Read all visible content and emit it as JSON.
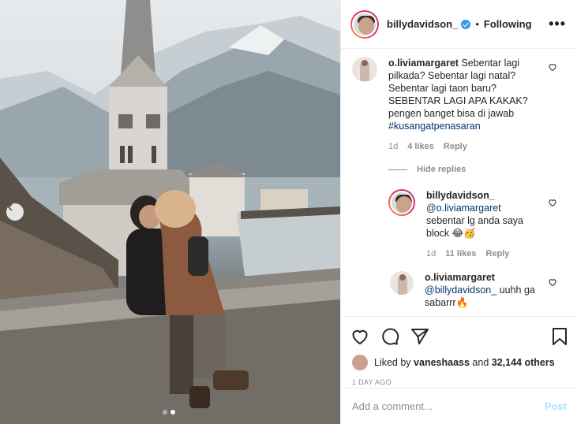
{
  "header": {
    "username": "billydavidson_",
    "separator": "•",
    "follow_status": "Following",
    "more_label": "•••"
  },
  "comments": [
    {
      "user": "o.liviamargaret",
      "text": "Sebentar lagi pilkada? Sebentar lagi natal? Sebentar lagi taon baru? SEBENTAR LAGI APA KAKAK? pengen banget bisa di jawab",
      "hashtag": "#kusangatpenasaran",
      "time": "1d",
      "likes": "4 likes",
      "reply": "Reply"
    }
  ],
  "hide_replies": "Hide replies",
  "replies": [
    {
      "user": "billydavidson_",
      "mention": "@o.liviamargaret",
      "text": "sebentar lg anda saya block 😂🥳",
      "time": "1d",
      "likes": "11 likes",
      "reply": "Reply"
    },
    {
      "user": "o.liviamargaret",
      "mention": "@billydavidson_",
      "text": " uuhh ga sabarrr🔥"
    }
  ],
  "likes": {
    "prefix": "Liked by ",
    "user": "vaneshaass",
    "middle": " and ",
    "count": "32,144 others"
  },
  "date": "1 DAY AGO",
  "comment_box": {
    "placeholder": "Add a comment...",
    "post_label": "Post"
  },
  "carousel": {
    "slide_count": 2,
    "active_index": 1
  },
  "icons": [
    "chevron-left-icon",
    "verified-icon",
    "heart-icon",
    "comment-icon",
    "share-icon",
    "bookmark-icon"
  ],
  "colors": {
    "link": "#00376b",
    "verified": "#3897f0",
    "muted": "#8e8e8e",
    "post_disabled": "#b2dffc"
  }
}
